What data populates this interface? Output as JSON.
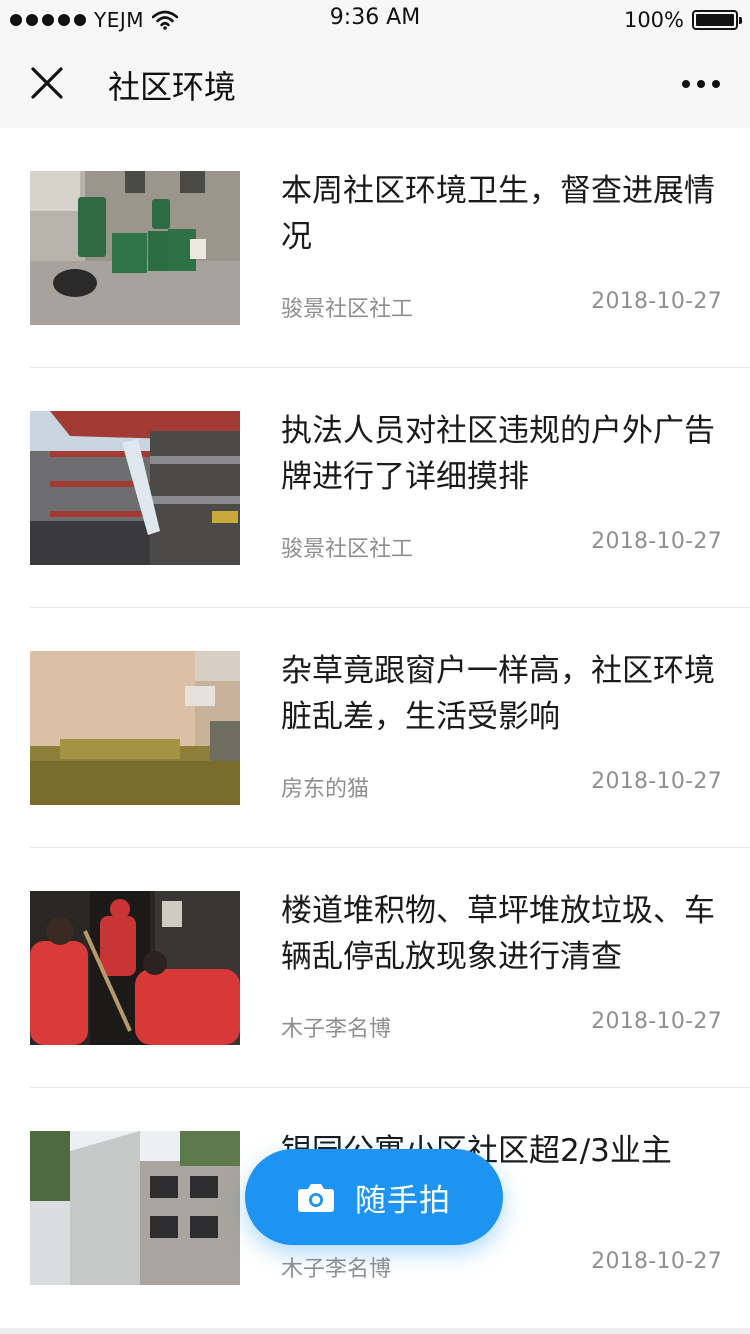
{
  "status_bar": {
    "carrier": "YEJM",
    "time": "9:36 AM",
    "battery_text": "100%",
    "battery_level": 1.0,
    "signal_icon": "signal-dots-icon",
    "wifi_icon": "wifi-icon",
    "battery_icon": "battery-icon"
  },
  "nav": {
    "title": "社区环境",
    "close_icon": "close-icon",
    "more_icon": "more-icon"
  },
  "articles": [
    {
      "title": "本周社区环境卫生，督查进展情况",
      "author": "骏景社区社工",
      "date": "2018-10-27"
    },
    {
      "title": "执法人员对社区违规的户外广告牌进行了详细摸排",
      "author": "骏景社区社工",
      "date": "2018-10-27"
    },
    {
      "title": "杂草竟跟窗户一样高，社区环境脏乱差，生活受影响",
      "author": "房东的猫",
      "date": "2018-10-27"
    },
    {
      "title": "楼道堆积物、草坪堆放垃圾、车辆乱停乱放现象进行清查",
      "author": "木子李名博",
      "date": "2018-10-27"
    },
    {
      "title": "银园公寓小区社区超2/3业主",
      "author": "木子李名博",
      "date": "2018-10-27"
    }
  ],
  "fab": {
    "label": "随手拍",
    "icon": "camera-icon",
    "color": "#1d94f2"
  },
  "colors": {
    "bar_background": "#f7f7f7",
    "meta_text": "#8f8f8f",
    "divider": "#e6e6e6"
  }
}
